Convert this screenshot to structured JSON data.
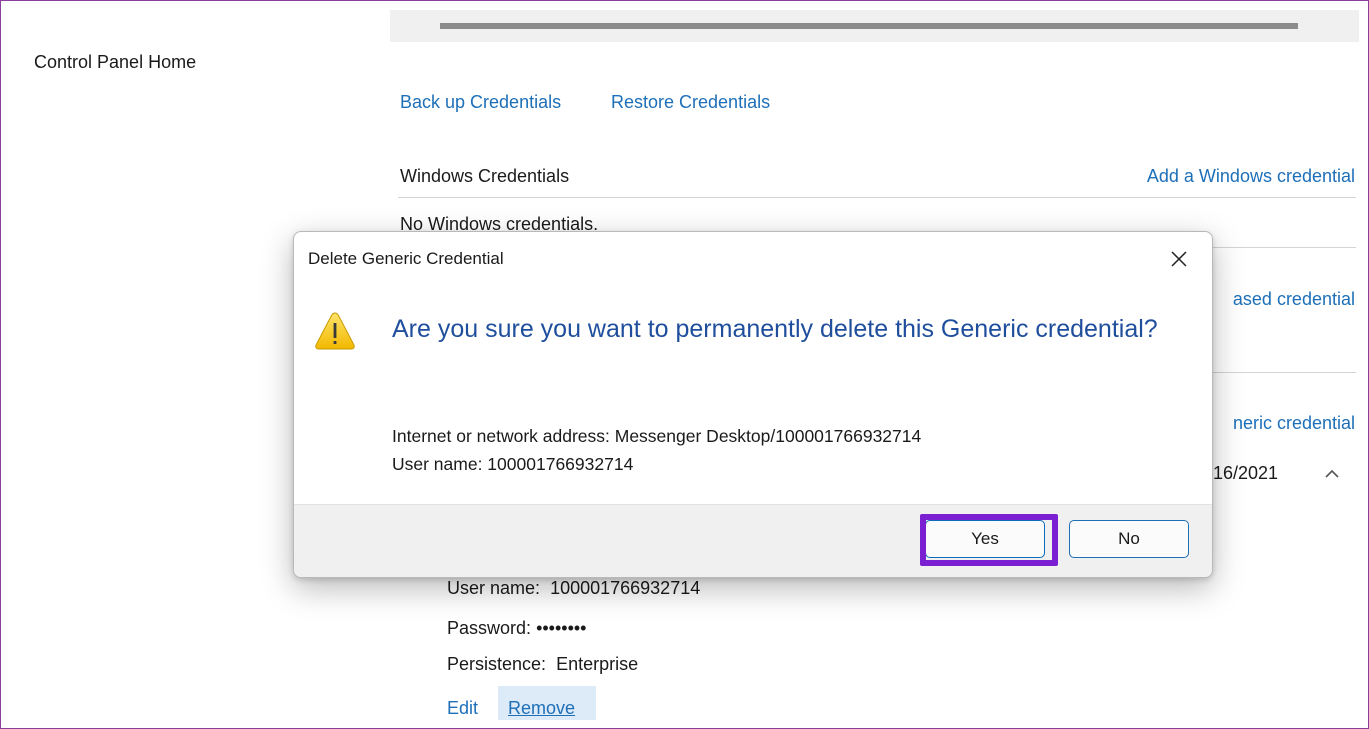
{
  "sidebar": {
    "home_link": "Control Panel Home"
  },
  "actions": {
    "backup": "Back up Credentials",
    "restore": "Restore Credentials"
  },
  "windows_section": {
    "heading": "Windows Credentials",
    "add_link": "Add a Windows credential",
    "empty_text": "No Windows credentials."
  },
  "cert_section": {
    "add_link_partial": "ased credential"
  },
  "generic_section": {
    "add_link_partial": "neric credential",
    "modified_partial": "/16/2021"
  },
  "entry": {
    "username_label": "User name:",
    "username_value": "100001766932714",
    "password_label": "Password:",
    "password_value": "••••••••",
    "persistence_label": "Persistence:",
    "persistence_value": "Enterprise",
    "edit": "Edit",
    "remove": "Remove"
  },
  "dialog": {
    "title": "Delete Generic Credential",
    "question": "Are you sure you want to permanently delete this Generic credential?",
    "address_line": "Internet or network address: Messenger Desktop/100001766932714",
    "user_line": "User name: 100001766932714",
    "yes": "Yes",
    "no": "No"
  },
  "colors": {
    "link": "#1d6fb8",
    "question": "#1f4e9d",
    "highlight": "#7a1fd1",
    "frame": "#8a3f9a"
  },
  "icons": {
    "warning": "warning-icon",
    "close": "close-icon",
    "collapse": "chevron-up-icon"
  }
}
